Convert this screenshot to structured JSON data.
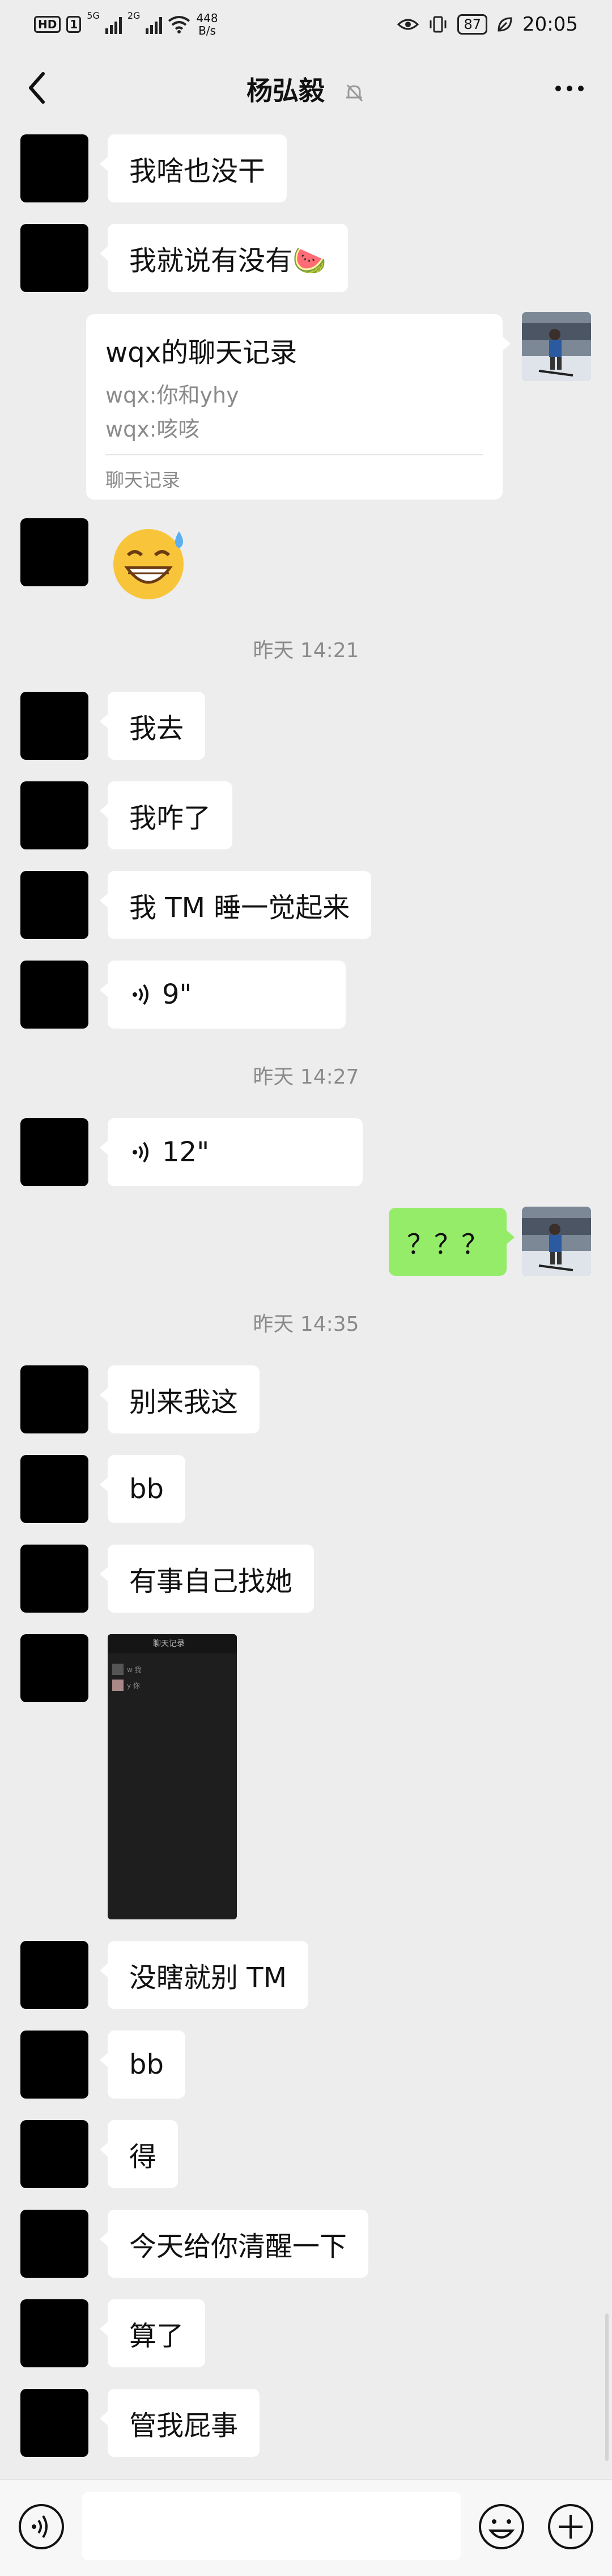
{
  "status_bar": {
    "left_chips": [
      "HD",
      "1"
    ],
    "network1": "5G",
    "network2": "2G",
    "speed_value": "448",
    "speed_unit": "B/s",
    "battery": "87",
    "time": "20:05"
  },
  "nav": {
    "title": "杨弘毅",
    "back_icon": "chevron-left-icon",
    "mute_icon": "bell-off-icon",
    "more_icon": "more-dots-icon"
  },
  "messages": {
    "m1": "我啥也没干",
    "m2": "我就说有没有🍉",
    "forward": {
      "title": "wqx的聊天记录",
      "line1": "wqx:你和yhy",
      "line2": "wqx:咳咳",
      "footer": "聊天记录"
    },
    "emoji": "😅",
    "ts1": "昨天 14:21",
    "m3": "我去",
    "m4": "我咋了",
    "m5": "我 TM 睡一觉起来",
    "voice1": "9\"",
    "ts2": "昨天 14:27",
    "voice2": "12\"",
    "mine1": "？？？",
    "ts3": "昨天 14:35",
    "m6": "别来我这",
    "m7": "bb",
    "m8": "有事自己找她",
    "m9": "没瞎就别 TM",
    "m10": "bb",
    "m11": "得",
    "m12": "今天给你清醒一下",
    "m13": "算了",
    "m14": "管我屁事"
  },
  "screenshot_image": {
    "header": "聊天记录",
    "row1": "w 我",
    "row2": "y 你"
  },
  "input_bar": {
    "voice_icon": "voice-icon",
    "emoji_icon": "emoji-icon",
    "plus_icon": "plus-icon"
  },
  "colors": {
    "background": "#ededed",
    "my_bubble": "#95ec69",
    "their_bubble": "#ffffff",
    "timestamp": "#8a8a8a"
  }
}
